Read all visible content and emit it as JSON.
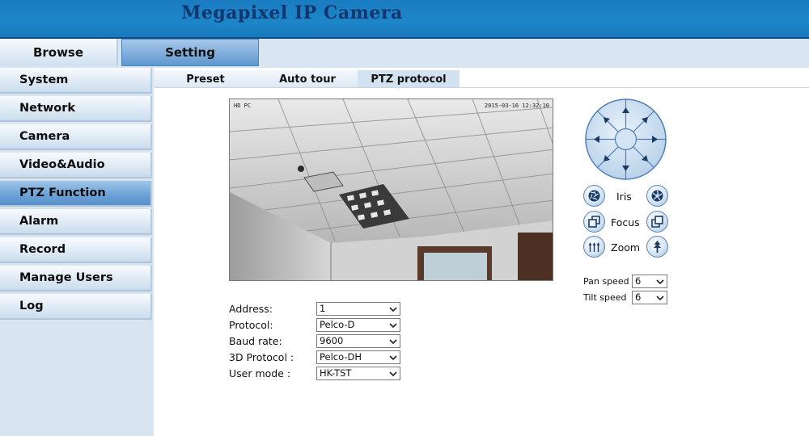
{
  "header": {
    "title": "Megapixel IP Camera"
  },
  "top_tabs": {
    "browse": "Browse",
    "setting": "Setting"
  },
  "sidebar": {
    "items": [
      {
        "label": "System"
      },
      {
        "label": "Network"
      },
      {
        "label": "Camera"
      },
      {
        "label": "Video&Audio"
      },
      {
        "label": "PTZ Function",
        "active": true
      },
      {
        "label": "Alarm"
      },
      {
        "label": "Record"
      },
      {
        "label": "Manage Users"
      },
      {
        "label": "Log"
      }
    ]
  },
  "sub_tabs": {
    "preset": "Preset",
    "auto_tour": "Auto tour",
    "ptz_protocol": "PTZ protocol"
  },
  "video": {
    "osd_left": "HD PC",
    "osd_right": "2015-03-16 12:32:10"
  },
  "form": {
    "address": {
      "label": "Address:",
      "value": "1"
    },
    "protocol": {
      "label": "Protocol:",
      "value": "Pelco-D"
    },
    "baud_rate": {
      "label": "Baud rate:",
      "value": "9600"
    },
    "protocol_3d": {
      "label": "3D Protocol :",
      "value": "Pelco-DH"
    },
    "user_mode": {
      "label": "User mode :",
      "value": "HK-TST"
    }
  },
  "ptz": {
    "iris_label": "Iris",
    "focus_label": "Focus",
    "zoom_label": "Zoom",
    "pan_speed": {
      "label": "Pan speed",
      "value": "6"
    },
    "tilt_speed": {
      "label": "Tilt speed",
      "value": "6"
    }
  },
  "colors": {
    "header_blue": "#1d86c9",
    "brand_text": "#12356e",
    "active_item": "#6aa1d6",
    "sidebar_bg": "#d8e5f1"
  },
  "icons": [
    "chevron-down-icon",
    "iris-open-icon",
    "iris-close-icon",
    "focus-near-icon",
    "focus-far-icon",
    "zoom-out-icon",
    "zoom-in-icon",
    "arrow-up-icon",
    "arrow-down-icon",
    "arrow-left-icon",
    "arrow-right-icon"
  ]
}
